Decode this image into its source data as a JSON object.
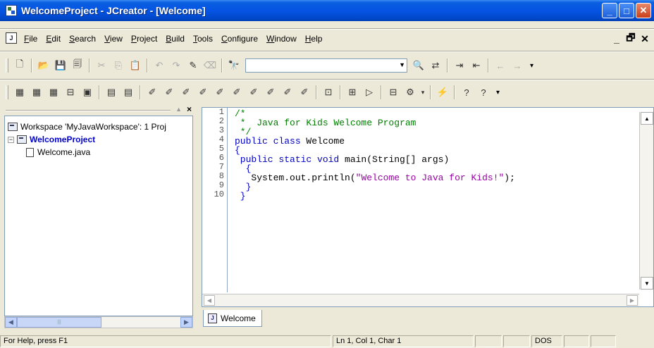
{
  "window": {
    "title": "WelcomeProject - JCreator - [Welcome]",
    "controls": {
      "minimize": "_",
      "maximize": "□",
      "close": "✕"
    }
  },
  "menubar": {
    "items": [
      {
        "pre": "",
        "accel": "F",
        "post": "ile"
      },
      {
        "pre": "",
        "accel": "E",
        "post": "dit"
      },
      {
        "pre": "",
        "accel": "S",
        "post": "earch"
      },
      {
        "pre": "",
        "accel": "V",
        "post": "iew"
      },
      {
        "pre": "",
        "accel": "P",
        "post": "roject"
      },
      {
        "pre": "",
        "accel": "B",
        "post": "uild"
      },
      {
        "pre": "",
        "accel": "T",
        "post": "ools"
      },
      {
        "pre": "",
        "accel": "C",
        "post": "onfigure"
      },
      {
        "pre": "",
        "accel": "W",
        "post": "indow"
      },
      {
        "pre": "",
        "accel": "H",
        "post": "elp"
      }
    ],
    "mdi": {
      "minimize": "_",
      "restore": "🗗",
      "close": "✕"
    }
  },
  "toolbar": {
    "find_combo_value": ""
  },
  "workspace": {
    "root": "Workspace 'MyJavaWorkspace': 1 Proj",
    "project": "WelcomeProject",
    "file": "Welcome.java",
    "expander": "−"
  },
  "editor": {
    "line_numbers": [
      "1",
      "2",
      "3",
      "4",
      "5",
      "6",
      "7",
      "8",
      "9",
      "10"
    ],
    "lines": [
      [
        {
          "t": "/*",
          "c": "comment"
        }
      ],
      [
        {
          "t": " *  Java for Kids Welcome Program",
          "c": "comment"
        }
      ],
      [
        {
          "t": " */",
          "c": "comment"
        }
      ],
      [
        {
          "t": "public class ",
          "c": "kw"
        },
        {
          "t": "Welcome",
          "c": ""
        }
      ],
      [
        {
          "t": "{",
          "c": "kw"
        }
      ],
      [
        {
          "t": " public static void ",
          "c": "kw"
        },
        {
          "t": "main(String[] args)",
          "c": ""
        }
      ],
      [
        {
          "t": "  {",
          "c": "kw"
        }
      ],
      [
        {
          "t": "   System.out.println(",
          "c": ""
        },
        {
          "t": "\"Welcome to Java for Kids!\"",
          "c": "str"
        },
        {
          "t": ");",
          "c": ""
        }
      ],
      [
        {
          "t": "  }",
          "c": "kw"
        }
      ],
      [
        {
          "t": " }",
          "c": "kw"
        }
      ]
    ]
  },
  "doc_tab": {
    "label": "Welcome",
    "icon_letter": "J"
  },
  "status": {
    "help": "For Help, press F1",
    "position": "Ln 1, Col 1, Char 1",
    "eol": "DOS"
  }
}
